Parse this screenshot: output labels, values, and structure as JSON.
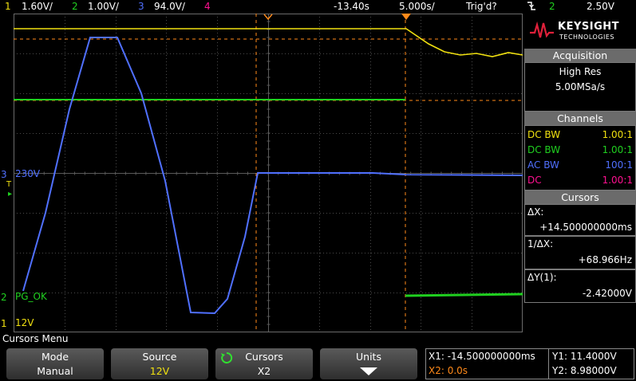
{
  "colors": {
    "ch1": "#f0e010",
    "ch2": "#20d020",
    "ch3": "#5070ff",
    "ch4": "#ff1090",
    "cursor": "#ff8a1a",
    "grid": "#4a4a4a"
  },
  "topbar": {
    "ch1_num": "1",
    "ch1_scale": "1.60V/",
    "ch2_num": "2",
    "ch2_scale": "1.00V/",
    "ch3_num": "3",
    "ch3_scale": "94.0V/",
    "ch4_num": "4",
    "delay": "-13.40s",
    "timebase": "5.000s/",
    "trig_status": "Trig'd?",
    "trig_icon": "falling-edge-icon",
    "trig_source": "2",
    "trig_level": "2.50V"
  },
  "logo": {
    "brand": "KEYSIGHT",
    "sub": "TECHNOLOGIES"
  },
  "acquisition": {
    "header": "Acquisition",
    "mode": "High Res",
    "rate": "5.00MSa/s"
  },
  "channels": {
    "header": "Channels",
    "rows": [
      {
        "coupling": "DC BW",
        "probe": "1.00:1"
      },
      {
        "coupling": "DC BW",
        "probe": "1.00:1"
      },
      {
        "coupling": "AC BW",
        "probe": "100:1"
      },
      {
        "coupling": "DC",
        "probe": "1.00:1"
      }
    ]
  },
  "cursors": {
    "header": "Cursors",
    "dx_label": "ΔX:",
    "dx_value": "+14.500000000ms",
    "inv_dx_label": "1/ΔX:",
    "inv_dx_value": "+68.966Hz",
    "dy_label": "ΔY(1):",
    "dy_value": "-2.42000V"
  },
  "markers": {
    "ch3_label": "230V",
    "ch2_label": "PG_OK",
    "ch1_label": "12V"
  },
  "menu": {
    "title": "Cursors Menu",
    "mode_label": "Mode",
    "mode_value": "Manual",
    "source_label": "Source",
    "source_value": "12V",
    "cursors_label": "Cursors",
    "cursors_value": "X2",
    "units_label": "Units"
  },
  "readout": {
    "x1": "X1: -14.500000000ms",
    "x2": "X2: 0.0s",
    "y1": "Y1: 11.4000V",
    "y2": "Y2: 8.98000V"
  }
}
